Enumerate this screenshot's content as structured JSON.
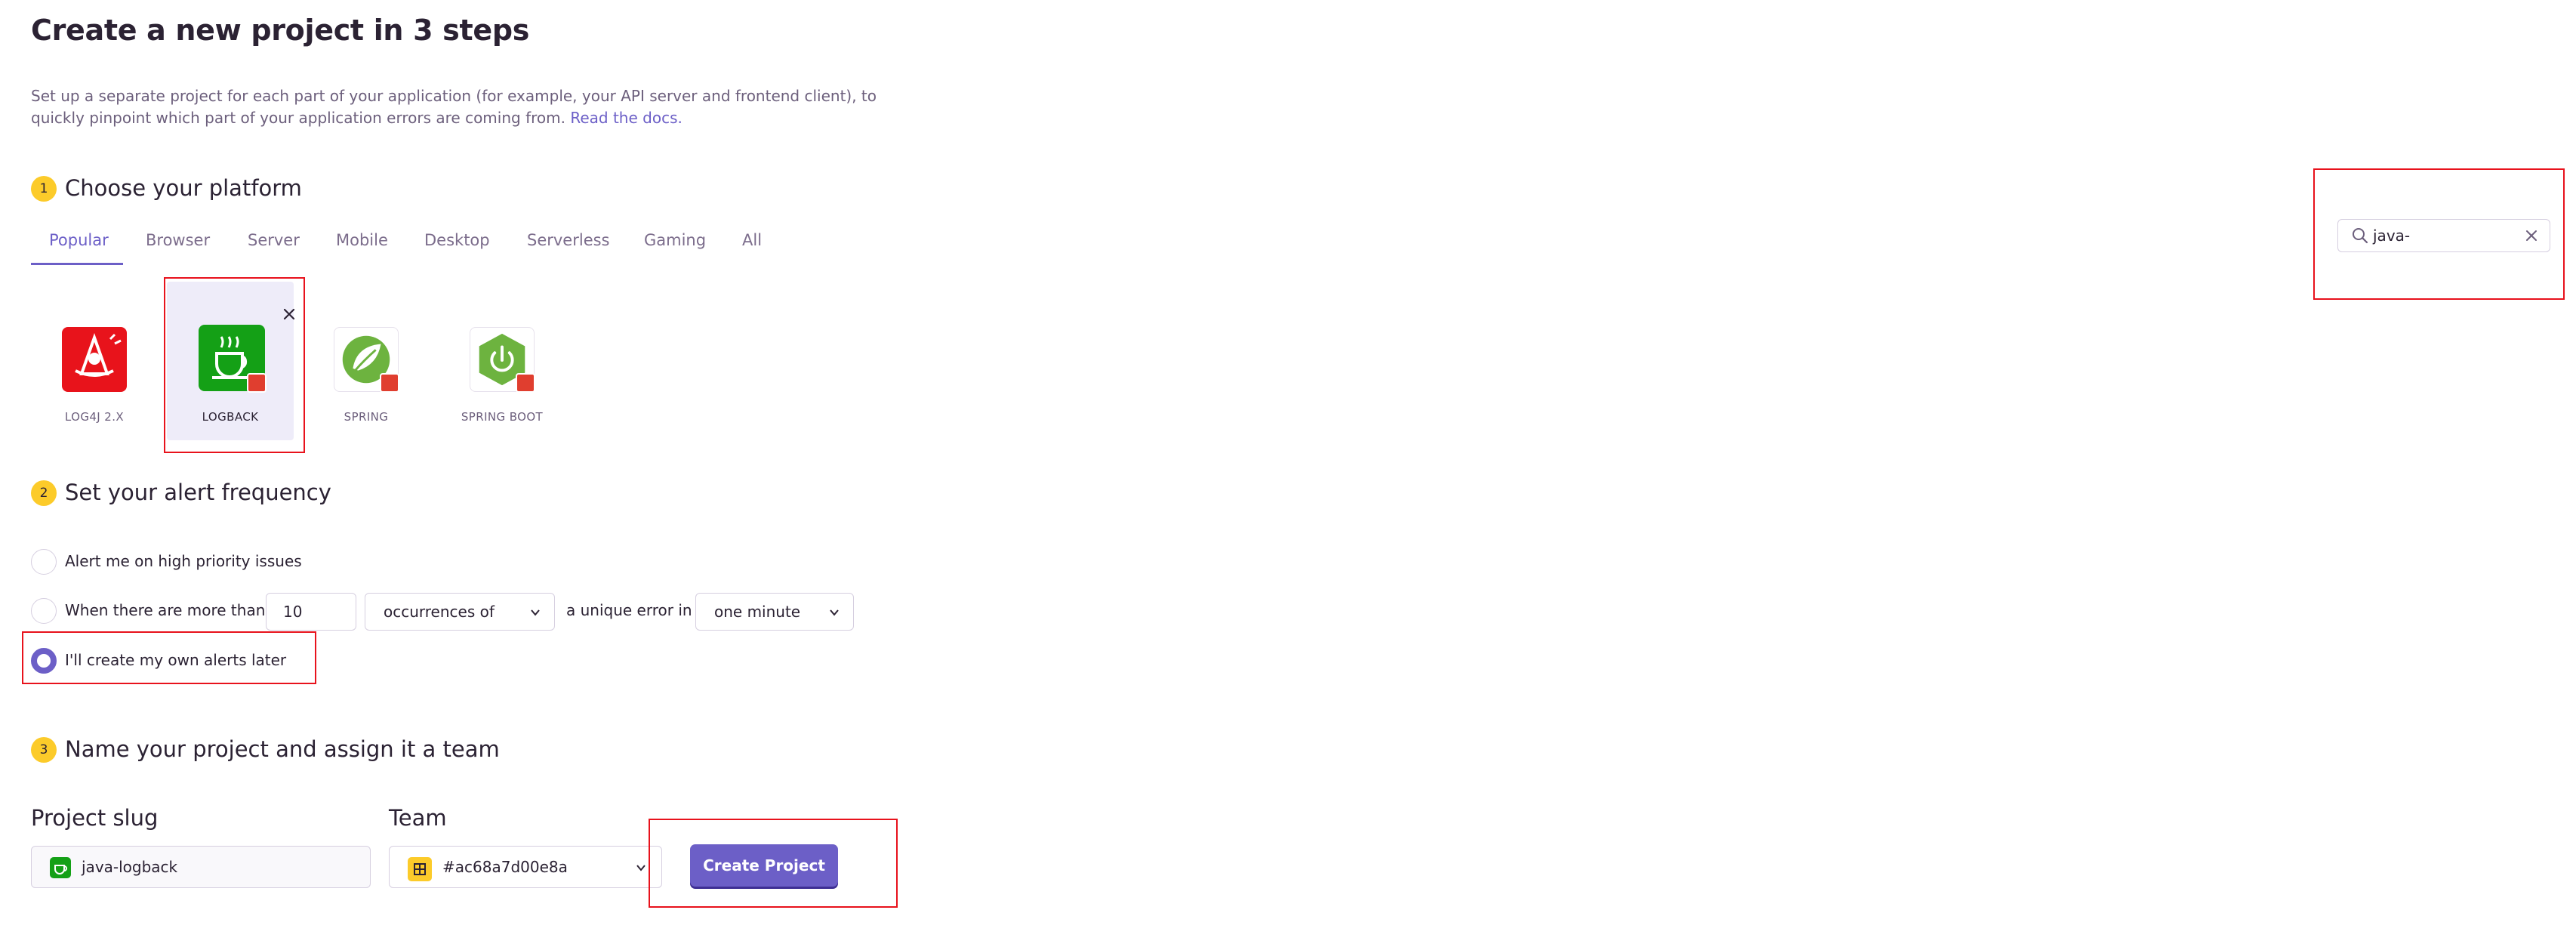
{
  "page": {
    "title": "Create a new project in 3 steps",
    "intro": "Set up a separate project for each part of your application (for example, your API server and frontend client), to quickly pinpoint which part of your application errors are coming from.",
    "docs_link": "Read the docs."
  },
  "steps": {
    "one": {
      "number": "1",
      "title": "Choose your platform"
    },
    "two": {
      "number": "2",
      "title": "Set your alert frequency"
    },
    "three": {
      "number": "3",
      "title": "Name your project and assign it a team"
    }
  },
  "tabs": [
    "Popular",
    "Browser",
    "Server",
    "Mobile",
    "Desktop",
    "Serverless",
    "Gaming",
    "All"
  ],
  "search": {
    "value": "java-"
  },
  "platforms": [
    {
      "label": "LOG4J 2.X",
      "icon": "log4j-icon",
      "selected": false
    },
    {
      "label": "LOGBACK",
      "icon": "logback-icon",
      "selected": true
    },
    {
      "label": "SPRING",
      "icon": "spring-icon",
      "selected": false
    },
    {
      "label": "SPRING BOOT",
      "icon": "spring-boot-icon",
      "selected": false
    }
  ],
  "alerts": {
    "option_high_priority": "Alert me on high priority issues",
    "option_threshold_prefix": "When there are more than",
    "threshold_value": "10",
    "metric_select": "occurrences of",
    "middle_text": "a unique error in",
    "interval_select": "one minute",
    "option_later": "I'll create my own alerts later",
    "selected": "later"
  },
  "project": {
    "slug_label": "Project slug",
    "slug_value": "java-logback",
    "team_label": "Team",
    "team_value": "#ac68a7d00e8a",
    "create_label": "Create Project"
  },
  "colors": {
    "accent": "#6c5fc7",
    "step_badge": "#fccb2a",
    "annotation": "#e8121c"
  }
}
